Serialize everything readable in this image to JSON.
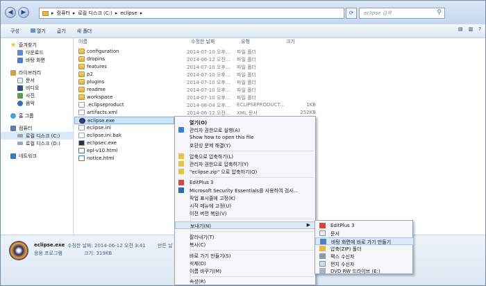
{
  "address": {
    "crumbs": [
      "컴퓨터",
      "로컬 디스크 (C:)",
      "eclipse"
    ],
    "search_placeholder": "eclipse 검색"
  },
  "toolbar": {
    "organize": "구성",
    "open": "열기",
    "share": "굽기",
    "new_folder": "새 폴더"
  },
  "sidebar": {
    "favorites": "즐겨찾기",
    "downloads": "다운로드",
    "desktop": "바탕 화면",
    "libraries": "라이브러리",
    "documents": "문서",
    "videos": "비디오",
    "pictures": "사진",
    "music": "음악",
    "homegroup": "홈 그룹",
    "computer": "컴퓨터",
    "drive_c": "로컬 디스크 (C:)",
    "drive_d": "로컬 디스크 (D:)",
    "network": "네트워크"
  },
  "columns": {
    "name": "이름",
    "date": "수정한 날짜",
    "type": "유형",
    "size": "크기"
  },
  "files": [
    {
      "name": "configuration",
      "date": "2014-07-10 오후...",
      "type": "파일 폴더",
      "size": ""
    },
    {
      "name": "dropins",
      "date": "2014-06-12 오전...",
      "type": "파일 폴더",
      "size": ""
    },
    {
      "name": "features",
      "date": "2014-07-10 오후...",
      "type": "파일 폴더",
      "size": ""
    },
    {
      "name": "p2",
      "date": "2014-07-10 오후...",
      "type": "파일 폴더",
      "size": ""
    },
    {
      "name": "plugins",
      "date": "2014-07-10 오후...",
      "type": "파일 폴더",
      "size": ""
    },
    {
      "name": "readme",
      "date": "2014-07-10 오후...",
      "type": "파일 폴더",
      "size": ""
    },
    {
      "name": "workspace",
      "date": "2014-07-10 오후...",
      "type": "파일 폴더",
      "size": ""
    },
    {
      "name": ".eclipseproduct",
      "date": "2014-06-04 오후...",
      "type": "ECLIPSEPRODUCT...",
      "size": "1KB"
    },
    {
      "name": "artifacts.xml",
      "date": "2014-06-12 오전...",
      "type": "XML 문서",
      "size": "252KB"
    },
    {
      "name": "eclipse.exe",
      "date": "",
      "type": "",
      "size": ""
    },
    {
      "name": "eclipse.ini",
      "date": "",
      "type": "",
      "size": ""
    },
    {
      "name": "eclipse.ini.bak",
      "date": "",
      "type": "",
      "size": ""
    },
    {
      "name": "eclipsec.exe",
      "date": "",
      "type": "",
      "size": ""
    },
    {
      "name": "epl-v10.html",
      "date": "",
      "type": "",
      "size": ""
    },
    {
      "name": "notice.html",
      "date": "",
      "type": "",
      "size": ""
    }
  ],
  "context_menu": {
    "open": "열기(O)",
    "run_as_admin": "관리자 권한으로 실행(A)",
    "show_how": "Show how to open this file",
    "troubleshoot": "호환성 문제 해결(Y)",
    "add_archive": "압축으로 압축하기(L)",
    "admin_archive": "관리자 권한으로 압축하기(Y)",
    "zip_archive": "\"eclipse.zip\" 으로 압축하기(Q)",
    "editplus": "EditPlus 3",
    "mse": "Microsoft Security Essentials를 사용하여 검사...",
    "pin_taskbar": "작업 표시줄에 고정(K)",
    "pin_start": "시작 메뉴에 고정(U)",
    "restore": "이전 버전 복원(V)",
    "send_to": "보내기(N)",
    "cut": "잘라내기(T)",
    "copy": "복사(C)",
    "create_shortcut": "바로 가기 만들기(S)",
    "delete": "삭제(D)",
    "rename": "이름 바꾸기(M)",
    "properties": "속성(R)"
  },
  "send_to_menu": {
    "editplus": "EditPlus 3",
    "documents": "문서",
    "desktop_shortcut": "바탕 화면에 바로 가기 만들기",
    "zip": "압축(ZIP) 폴더",
    "fax": "팩스 수신자",
    "mail": "편지 수신자",
    "dvd": "DVD RW 드라이브 (E:)"
  },
  "status": {
    "filename": "eclipse.exe",
    "filetype": "응용 프로그램",
    "modified_label": "수정한 날짜: 2014-06-12 오전 3:41",
    "created_label": "만든 날",
    "size_label": "크기: 319KB"
  }
}
